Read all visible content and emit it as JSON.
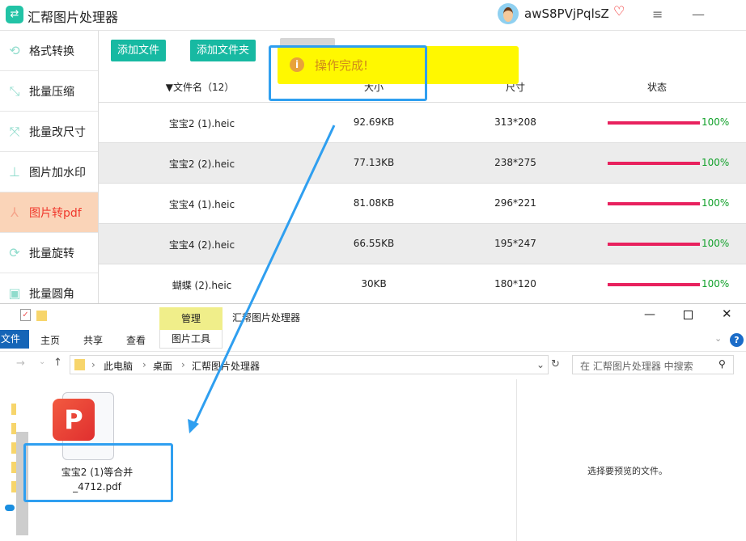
{
  "app": {
    "title": "汇帮图片处理器",
    "user": "awS8PVjPqlsZ",
    "logo_icon": "swap-icon"
  },
  "sidebar": {
    "items": [
      {
        "label": "格式转换",
        "icon": "format-convert-icon"
      },
      {
        "label": "批量压缩",
        "icon": "compress-icon"
      },
      {
        "label": "批量改尺寸",
        "icon": "resize-icon"
      },
      {
        "label": "图片加水印",
        "icon": "watermark-icon"
      },
      {
        "label": "图片转pdf",
        "icon": "pdf-icon",
        "active": true
      },
      {
        "label": "批量旋转",
        "icon": "rotate-icon"
      },
      {
        "label": "批量圆角",
        "icon": "rounded-corner-icon"
      }
    ]
  },
  "toolbar": {
    "add_file": "添加文件",
    "add_folder": "添加文件夹"
  },
  "toast": {
    "text": "操作完成!",
    "color": "#fff800"
  },
  "table": {
    "headers": {
      "name": "▼文件名（12）",
      "size": "大小",
      "dim": "尺寸",
      "status": "状态"
    },
    "rows": [
      {
        "name": "宝宝2 (1).heic",
        "size": "92.69KB",
        "dim": "313*208",
        "progress": "100%"
      },
      {
        "name": "宝宝2 (2).heic",
        "size": "77.13KB",
        "dim": "238*275",
        "progress": "100%"
      },
      {
        "name": "宝宝4 (1).heic",
        "size": "81.08KB",
        "dim": "296*221",
        "progress": "100%"
      },
      {
        "name": "宝宝4 (2).heic",
        "size": "66.55KB",
        "dim": "195*247",
        "progress": "100%"
      },
      {
        "name": "蝴蝶 (2).heic",
        "size": "30KB",
        "dim": "180*120",
        "progress": "100%"
      }
    ]
  },
  "explorer": {
    "title": "汇帮图片处理器",
    "manage": "管理",
    "tabs": [
      "文件",
      "主页",
      "共享",
      "查看",
      "图片工具"
    ],
    "path": [
      "此电脑",
      "桌面",
      "汇帮图片处理器"
    ],
    "search_placeholder": "在 汇帮图片处理器 中搜索",
    "file": {
      "line1": "宝宝2 (1)等合并",
      "line2": "_4712.pdf"
    },
    "preview": "选择要预览的文件。"
  },
  "colors": {
    "accent": "#17b9a2",
    "highlight": "#2f9ff0",
    "progress": "#e8215e"
  }
}
